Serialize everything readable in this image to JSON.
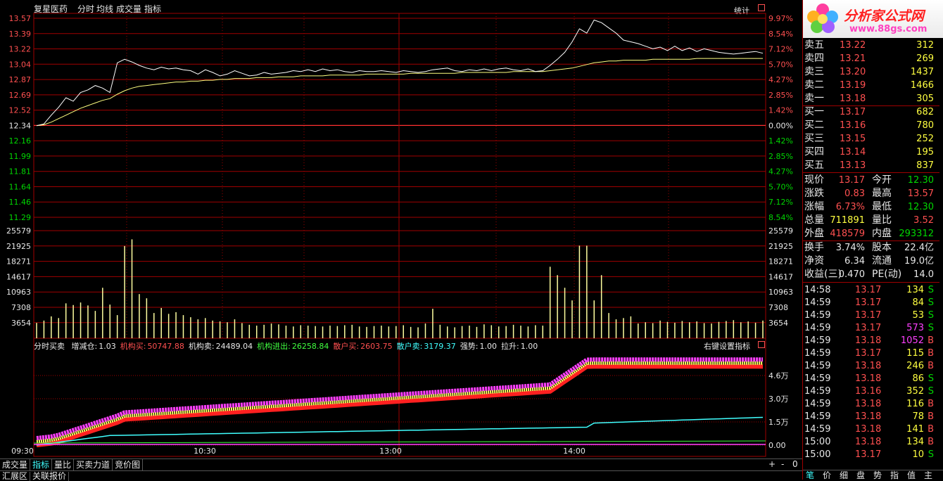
{
  "header": {
    "stock_name": "复星医药",
    "menu": [
      "分时",
      "均线",
      "成交量",
      "指标"
    ],
    "stats_label": "统计"
  },
  "price_axis": {
    "left": [
      "13.57",
      "13.39",
      "13.22",
      "13.04",
      "12.87",
      "12.69",
      "12.52",
      "12.34",
      "12.16",
      "11.99",
      "11.81",
      "11.64",
      "11.46",
      "11.29"
    ],
    "right": [
      "9.97%",
      "8.54%",
      "7.12%",
      "5.70%",
      "4.27%",
      "2.85%",
      "1.42%",
      "0.00%",
      "1.42%",
      "2.85%",
      "4.27%",
      "5.70%",
      "7.12%",
      "8.54%"
    ],
    "base_index": 7
  },
  "volume_axis": {
    "left": [
      "25579",
      "21925",
      "18271",
      "14617",
      "10963",
      "7308",
      "3654"
    ],
    "right": [
      "25579",
      "21925",
      "18271",
      "14617",
      "10963",
      "7308",
      "3654"
    ]
  },
  "indicator": {
    "name": "分时买卖",
    "items": [
      {
        "label": "增减仓:",
        "value": "1.03",
        "color": "#e8e8e8"
      },
      {
        "label": "机构买:",
        "value": "50747.88",
        "color": "#ff5050"
      },
      {
        "label": "机构卖:",
        "value": "24489.04",
        "color": "#e8e8e8"
      },
      {
        "label": "机构进出:",
        "value": "26258.84",
        "color": "#40ff40"
      },
      {
        "label": "散户买:",
        "value": "2603.75",
        "color": "#ff5050"
      },
      {
        "label": "散户卖:",
        "value": "3179.37",
        "color": "#40ffff"
      },
      {
        "label": "强势:",
        "value": "1.00",
        "color": "#e8e8e8"
      },
      {
        "label": "拉升:",
        "value": "1.00",
        "color": "#e8e8e8"
      }
    ],
    "settings_label": "右键设置指标",
    "axis": [
      "4.6万",
      "3.0万",
      "1.5万",
      "0.00"
    ]
  },
  "time_axis": [
    "09:30",
    "10:30",
    "13:00",
    "14:00"
  ],
  "bottom_tabs": [
    "成交量",
    "指标",
    "量比",
    "买卖力道",
    "竞价图"
  ],
  "bottom_tabs2": [
    "汇展区",
    "关联报价"
  ],
  "zoom_controls": [
    "+",
    "-",
    "0"
  ],
  "logo": {
    "title": "分析家公式网",
    "url": "www.88gs.com"
  },
  "order_book": {
    "sell": [
      {
        "label": "卖五",
        "price": "13.22",
        "vol": "312"
      },
      {
        "label": "卖四",
        "price": "13.21",
        "vol": "269"
      },
      {
        "label": "卖三",
        "price": "13.20",
        "vol": "1437"
      },
      {
        "label": "卖二",
        "price": "13.19",
        "vol": "1466"
      },
      {
        "label": "卖一",
        "price": "13.18",
        "vol": "305"
      }
    ],
    "buy": [
      {
        "label": "买一",
        "price": "13.17",
        "vol": "682"
      },
      {
        "label": "买二",
        "price": "13.16",
        "vol": "780"
      },
      {
        "label": "买三",
        "price": "13.15",
        "vol": "252"
      },
      {
        "label": "买四",
        "price": "13.14",
        "vol": "195"
      },
      {
        "label": "买五",
        "price": "13.13",
        "vol": "837"
      }
    ]
  },
  "quote": {
    "rows": [
      [
        {
          "l": "现价",
          "v": "13.17",
          "c": "red"
        },
        {
          "l": "今开",
          "v": "12.30",
          "c": "grn"
        }
      ],
      [
        {
          "l": "涨跌",
          "v": "0.83",
          "c": "red"
        },
        {
          "l": "最高",
          "v": "13.57",
          "c": "red"
        }
      ],
      [
        {
          "l": "涨幅",
          "v": "6.73%",
          "c": "red"
        },
        {
          "l": "最低",
          "v": "12.30",
          "c": "grn"
        }
      ],
      [
        {
          "l": "总量",
          "v": "711891",
          "c": "yel"
        },
        {
          "l": "量比",
          "v": "3.52",
          "c": "red"
        }
      ],
      [
        {
          "l": "外盘",
          "v": "418579",
          "c": "red"
        },
        {
          "l": "内盘",
          "v": "293312",
          "c": "grn"
        }
      ]
    ],
    "rows2": [
      [
        {
          "l": "换手",
          "v": "3.74%",
          "c": "wht"
        },
        {
          "l": "股本",
          "v": "22.4亿",
          "c": "wht"
        }
      ],
      [
        {
          "l": "净资",
          "v": "6.34",
          "c": "wht"
        },
        {
          "l": "流通",
          "v": "19.0亿",
          "c": "wht"
        }
      ],
      [
        {
          "l": "收益(三)",
          "v": "0.470",
          "c": "wht"
        },
        {
          "l": "PE(动)",
          "v": "14.0",
          "c": "wht"
        }
      ]
    ]
  },
  "trades": [
    {
      "time": "14:58",
      "price": "13.17",
      "vol": "134",
      "side": "S",
      "vcolor": "yel"
    },
    {
      "time": "14:59",
      "price": "13.17",
      "vol": "84",
      "side": "S",
      "vcolor": "yel"
    },
    {
      "time": "14:59",
      "price": "13.17",
      "vol": "53",
      "side": "S",
      "vcolor": "yel"
    },
    {
      "time": "14:59",
      "price": "13.17",
      "vol": "573",
      "side": "S",
      "vcolor": "mag"
    },
    {
      "time": "14:59",
      "price": "13.18",
      "vol": "1052",
      "side": "B",
      "vcolor": "mag"
    },
    {
      "time": "14:59",
      "price": "13.17",
      "vol": "115",
      "side": "B",
      "vcolor": "yel"
    },
    {
      "time": "14:59",
      "price": "13.18",
      "vol": "246",
      "side": "B",
      "vcolor": "yel"
    },
    {
      "time": "14:59",
      "price": "13.18",
      "vol": "86",
      "side": "S",
      "vcolor": "yel"
    },
    {
      "time": "14:59",
      "price": "13.16",
      "vol": "352",
      "side": "S",
      "vcolor": "yel"
    },
    {
      "time": "14:59",
      "price": "13.18",
      "vol": "116",
      "side": "B",
      "vcolor": "yel"
    },
    {
      "time": "14:59",
      "price": "13.18",
      "vol": "78",
      "side": "B",
      "vcolor": "yel"
    },
    {
      "time": "14:59",
      "price": "13.18",
      "vol": "141",
      "side": "B",
      "vcolor": "yel"
    },
    {
      "time": "15:00",
      "price": "13.18",
      "vol": "134",
      "side": "B",
      "vcolor": "yel"
    },
    {
      "time": "15:00",
      "price": "13.17",
      "vol": "10",
      "side": "S",
      "vcolor": "yel"
    }
  ],
  "side_tabs": [
    "笔",
    "价",
    "细",
    "盘",
    "势",
    "指",
    "值",
    "主"
  ],
  "colors": {
    "grid": "#a00000",
    "price_line": "#ffffff",
    "avg_line": "#ffff80",
    "up": "#ff5050",
    "down": "#00d600",
    "cyan": "#40ffff",
    "magenta": "#ff40ff"
  },
  "chart_data": {
    "type": "line",
    "title": "",
    "xlabel": "",
    "ylabel": "",
    "x_ticks": [
      "09:30",
      "10:30",
      "13:00",
      "14:00"
    ],
    "ylim": [
      11.11,
      13.57
    ],
    "prev_close": 12.34,
    "series": [
      {
        "values": [
          12.34,
          12.36,
          12.46,
          12.55,
          12.66,
          12.62,
          12.72,
          12.75,
          12.8,
          12.77,
          12.72,
          13.06,
          13.1,
          13.07,
          13.03,
          13.0,
          12.98,
          13.01,
          12.99,
          13.0,
          12.98,
          12.97,
          12.93,
          12.98,
          12.95,
          12.91,
          12.93,
          12.97,
          12.94,
          12.91,
          12.92,
          12.95,
          12.93,
          12.94,
          12.95,
          12.97,
          12.96,
          12.98,
          12.96,
          12.99,
          12.97,
          12.98,
          12.96,
          12.95,
          12.97,
          12.96,
          12.96,
          12.97,
          12.96,
          12.95,
          12.97,
          12.96,
          12.95,
          12.96,
          12.98,
          12.99,
          13.0,
          12.97,
          12.96,
          12.98,
          12.97,
          12.99,
          12.97,
          12.99,
          13.0,
          12.98,
          12.97,
          12.99,
          12.96,
          12.97,
          13.03,
          13.1,
          13.18,
          13.3,
          13.45,
          13.4,
          13.55,
          13.52,
          13.46,
          13.4,
          13.32,
          13.3,
          13.28,
          13.25,
          13.22,
          13.24,
          13.2,
          13.25,
          13.2,
          13.23,
          13.19,
          13.22,
          13.2,
          13.18,
          13.17,
          13.16,
          13.17,
          13.18,
          13.19,
          13.17
        ]
      },
      {
        "values": [
          12.34,
          12.35,
          12.38,
          12.42,
          12.46,
          12.5,
          12.54,
          12.57,
          12.6,
          12.63,
          12.65,
          12.7,
          12.74,
          12.77,
          12.79,
          12.8,
          12.81,
          12.82,
          12.83,
          12.84,
          12.84,
          12.85,
          12.85,
          12.86,
          12.86,
          12.87,
          12.87,
          12.88,
          12.88,
          12.88,
          12.89,
          12.89,
          12.89,
          12.9,
          12.9,
          12.9,
          12.91,
          12.91,
          12.91,
          12.91,
          12.92,
          12.92,
          12.92,
          12.92,
          12.92,
          12.93,
          12.93,
          12.93,
          12.93,
          12.93,
          12.93,
          12.94,
          12.94,
          12.94,
          12.94,
          12.94,
          12.94,
          12.94,
          12.95,
          12.95,
          12.95,
          12.95,
          12.95,
          12.95,
          12.95,
          12.96,
          12.96,
          12.96,
          12.96,
          12.96,
          12.97,
          12.98,
          12.99,
          13.0,
          13.02,
          13.04,
          13.06,
          13.07,
          13.08,
          13.08,
          13.09,
          13.09,
          13.09,
          13.09,
          13.1,
          13.1,
          13.1,
          13.1,
          13.1,
          13.1,
          13.11,
          13.11,
          13.11,
          13.11,
          13.11,
          13.11,
          13.11,
          13.11,
          13.11,
          13.11
        ]
      }
    ],
    "volume": [
      3654,
      4200,
      5200,
      4800,
      8300,
      7900,
      8500,
      7800,
      6500,
      12000,
      8000,
      5500,
      21925,
      23500,
      10500,
      9500,
      6000,
      7200,
      5800,
      6200,
      5500,
      5000,
      4500,
      4800,
      4200,
      4000,
      3800,
      4500,
      3600,
      3200,
      3000,
      3200,
      3500,
      3300,
      3000,
      2800,
      3100,
      3000,
      2900,
      2800,
      3000,
      2900,
      3100,
      3200,
      2800,
      2700,
      2900,
      3000,
      2800,
      2900,
      3100,
      2700,
      2600,
      3500,
      7000,
      3200,
      2800,
      2600,
      2900,
      3000,
      2700,
      3300,
      3100,
      2800,
      2900,
      3200,
      3000,
      2800,
      3100,
      3000,
      17000,
      15000,
      12000,
      9000,
      22000,
      22000,
      9000,
      15000,
      6000,
      4500,
      4800,
      5200,
      3500,
      3800,
      3600,
      4200,
      3900,
      3700,
      4100,
      3800,
      4000,
      3600,
      3500,
      3900,
      4100,
      4300,
      3800,
      4000,
      3700,
      4200
    ]
  }
}
